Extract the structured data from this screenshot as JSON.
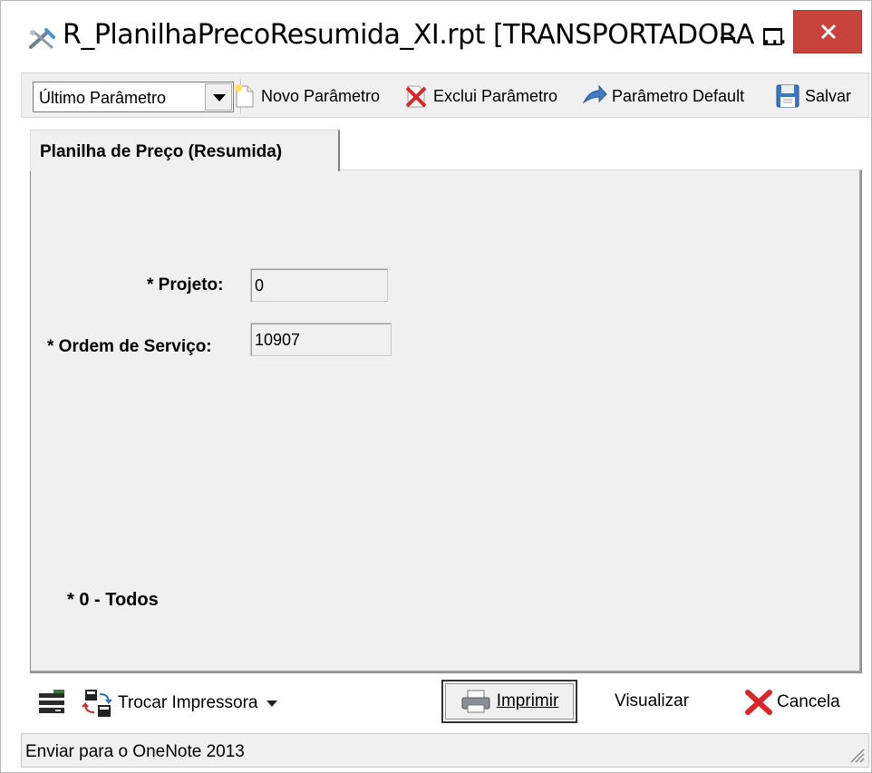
{
  "window": {
    "title": "R_PlanilhaPrecoResumida_XI.rpt [TRANSPORTADORA ..."
  },
  "toolbar": {
    "param_select_value": "Último Parâmetro",
    "new_param_label": "Novo Parâmetro",
    "delete_param_label": "Exclui Parâmetro",
    "default_param_label": "Parâmetro Default",
    "save_label": "Salvar"
  },
  "tab": {
    "label": "Planilha de Preço (Resumida)"
  },
  "form": {
    "projeto_label": "* Projeto:",
    "projeto_value": "0",
    "ordem_label": "* Ordem de Serviço:",
    "ordem_value": "10907",
    "note": "* 0 - Todos"
  },
  "bottom": {
    "change_printer_label": "Trocar Impressora",
    "print_label": "Imprimir",
    "preview_label": "Visualizar",
    "cancel_label": "Cancela"
  },
  "status": {
    "text": "Enviar para o OneNote 2013"
  },
  "colors": {
    "close_button": "#c7433b",
    "panel_bg": "#f0f0f0",
    "cancel_red": "#d8262b",
    "accent_blue": "#2f6fb5"
  },
  "icons": {
    "app": "tools-icon",
    "new": "new-document-icon",
    "delete": "delete-icon",
    "default": "default-arrow-icon",
    "save": "floppy-disk-icon",
    "printer_settings": "printer-settings-icon",
    "swap_printer": "swap-printer-icon",
    "print": "printer-icon",
    "cancel": "cancel-x-icon"
  }
}
